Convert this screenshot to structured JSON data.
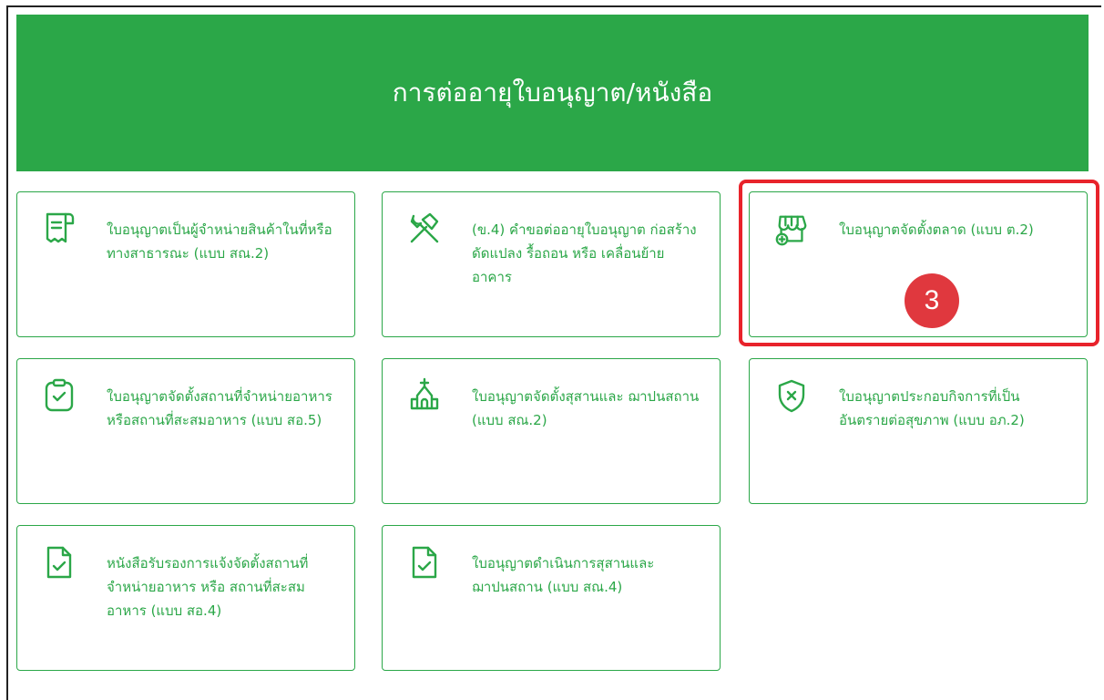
{
  "banner": {
    "title": "การต่ออายุใบอนุญาต/หนังสือ"
  },
  "cards": [
    {
      "label": "ใบอนุญาตเป็นผู้จำหน่ายสินค้าในที่หรือทางสาธารณะ (แบบ สณ.2)",
      "icon": "receipt-icon"
    },
    {
      "label": "(ข.4) คำขอต่ออายุใบอนุญาต ก่อสร้าง ดัดแปลง รื้อถอน หรือ เคลื่อนย้ายอาคาร",
      "icon": "tools-icon"
    },
    {
      "label": "ใบอนุญาตจัดตั้งตลาด (แบบ ต.2)",
      "icon": "market-stall-icon"
    },
    {
      "label": "ใบอนุญาตจัดตั้งสถานที่จำหน่ายอาหาร หรือสถานที่สะสมอาหาร (แบบ สอ.5)",
      "icon": "clipboard-check-icon"
    },
    {
      "label": "ใบอนุญาตจัดตั้งสุสานและ ฌาปนสถาน (แบบ สณ.2)",
      "icon": "church-icon"
    },
    {
      "label": "ใบอนุญาตประกอบกิจการที่เป็นอันตรายต่อสุขภาพ (แบบ อภ.2)",
      "icon": "shield-x-icon"
    },
    {
      "label": "หนังสือรับรองการแจ้งจัดตั้งสถานที่จำหน่ายอาหาร หรือ สถานที่สะสม อาหาร (แบบ สอ.4)",
      "icon": "file-check-icon"
    },
    {
      "label": "ใบอนุญาตดำเนินการสุสานและ ฌาปนสถาน (แบบ สณ.4)",
      "icon": "file-check-icon"
    }
  ],
  "annotation": {
    "step": "3"
  },
  "colors": {
    "accent": "#2ba748",
    "highlight": "#e8232b"
  }
}
